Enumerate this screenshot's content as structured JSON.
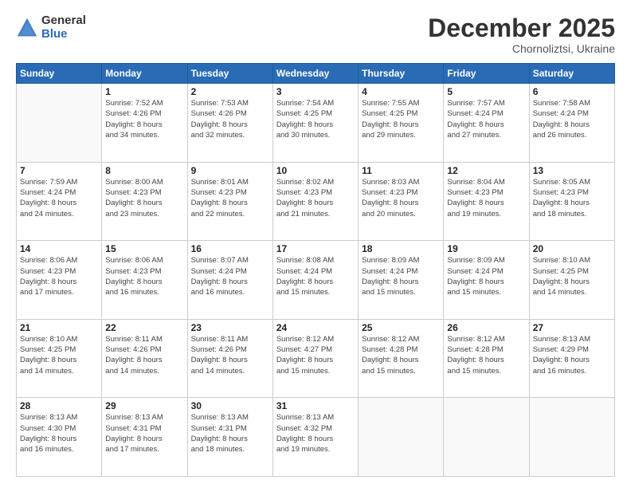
{
  "logo": {
    "general": "General",
    "blue": "Blue"
  },
  "title": "December 2025",
  "location": "Chornoliztsi, Ukraine",
  "weekdays": [
    "Sunday",
    "Monday",
    "Tuesday",
    "Wednesday",
    "Thursday",
    "Friday",
    "Saturday"
  ],
  "weeks": [
    [
      {
        "day": "",
        "info": ""
      },
      {
        "day": "1",
        "info": "Sunrise: 7:52 AM\nSunset: 4:26 PM\nDaylight: 8 hours\nand 34 minutes."
      },
      {
        "day": "2",
        "info": "Sunrise: 7:53 AM\nSunset: 4:26 PM\nDaylight: 8 hours\nand 32 minutes."
      },
      {
        "day": "3",
        "info": "Sunrise: 7:54 AM\nSunset: 4:25 PM\nDaylight: 8 hours\nand 30 minutes."
      },
      {
        "day": "4",
        "info": "Sunrise: 7:55 AM\nSunset: 4:25 PM\nDaylight: 8 hours\nand 29 minutes."
      },
      {
        "day": "5",
        "info": "Sunrise: 7:57 AM\nSunset: 4:24 PM\nDaylight: 8 hours\nand 27 minutes."
      },
      {
        "day": "6",
        "info": "Sunrise: 7:58 AM\nSunset: 4:24 PM\nDaylight: 8 hours\nand 26 minutes."
      }
    ],
    [
      {
        "day": "7",
        "info": "Sunrise: 7:59 AM\nSunset: 4:24 PM\nDaylight: 8 hours\nand 24 minutes."
      },
      {
        "day": "8",
        "info": "Sunrise: 8:00 AM\nSunset: 4:23 PM\nDaylight: 8 hours\nand 23 minutes."
      },
      {
        "day": "9",
        "info": "Sunrise: 8:01 AM\nSunset: 4:23 PM\nDaylight: 8 hours\nand 22 minutes."
      },
      {
        "day": "10",
        "info": "Sunrise: 8:02 AM\nSunset: 4:23 PM\nDaylight: 8 hours\nand 21 minutes."
      },
      {
        "day": "11",
        "info": "Sunrise: 8:03 AM\nSunset: 4:23 PM\nDaylight: 8 hours\nand 20 minutes."
      },
      {
        "day": "12",
        "info": "Sunrise: 8:04 AM\nSunset: 4:23 PM\nDaylight: 8 hours\nand 19 minutes."
      },
      {
        "day": "13",
        "info": "Sunrise: 8:05 AM\nSunset: 4:23 PM\nDaylight: 8 hours\nand 18 minutes."
      }
    ],
    [
      {
        "day": "14",
        "info": "Sunrise: 8:06 AM\nSunset: 4:23 PM\nDaylight: 8 hours\nand 17 minutes."
      },
      {
        "day": "15",
        "info": "Sunrise: 8:06 AM\nSunset: 4:23 PM\nDaylight: 8 hours\nand 16 minutes."
      },
      {
        "day": "16",
        "info": "Sunrise: 8:07 AM\nSunset: 4:24 PM\nDaylight: 8 hours\nand 16 minutes."
      },
      {
        "day": "17",
        "info": "Sunrise: 8:08 AM\nSunset: 4:24 PM\nDaylight: 8 hours\nand 15 minutes."
      },
      {
        "day": "18",
        "info": "Sunrise: 8:09 AM\nSunset: 4:24 PM\nDaylight: 8 hours\nand 15 minutes."
      },
      {
        "day": "19",
        "info": "Sunrise: 8:09 AM\nSunset: 4:24 PM\nDaylight: 8 hours\nand 15 minutes."
      },
      {
        "day": "20",
        "info": "Sunrise: 8:10 AM\nSunset: 4:25 PM\nDaylight: 8 hours\nand 14 minutes."
      }
    ],
    [
      {
        "day": "21",
        "info": "Sunrise: 8:10 AM\nSunset: 4:25 PM\nDaylight: 8 hours\nand 14 minutes."
      },
      {
        "day": "22",
        "info": "Sunrise: 8:11 AM\nSunset: 4:26 PM\nDaylight: 8 hours\nand 14 minutes."
      },
      {
        "day": "23",
        "info": "Sunrise: 8:11 AM\nSunset: 4:26 PM\nDaylight: 8 hours\nand 14 minutes."
      },
      {
        "day": "24",
        "info": "Sunrise: 8:12 AM\nSunset: 4:27 PM\nDaylight: 8 hours\nand 15 minutes."
      },
      {
        "day": "25",
        "info": "Sunrise: 8:12 AM\nSunset: 4:28 PM\nDaylight: 8 hours\nand 15 minutes."
      },
      {
        "day": "26",
        "info": "Sunrise: 8:12 AM\nSunset: 4:28 PM\nDaylight: 8 hours\nand 15 minutes."
      },
      {
        "day": "27",
        "info": "Sunrise: 8:13 AM\nSunset: 4:29 PM\nDaylight: 8 hours\nand 16 minutes."
      }
    ],
    [
      {
        "day": "28",
        "info": "Sunrise: 8:13 AM\nSunset: 4:30 PM\nDaylight: 8 hours\nand 16 minutes."
      },
      {
        "day": "29",
        "info": "Sunrise: 8:13 AM\nSunset: 4:31 PM\nDaylight: 8 hours\nand 17 minutes."
      },
      {
        "day": "30",
        "info": "Sunrise: 8:13 AM\nSunset: 4:31 PM\nDaylight: 8 hours\nand 18 minutes."
      },
      {
        "day": "31",
        "info": "Sunrise: 8:13 AM\nSunset: 4:32 PM\nDaylight: 8 hours\nand 19 minutes."
      },
      {
        "day": "",
        "info": ""
      },
      {
        "day": "",
        "info": ""
      },
      {
        "day": "",
        "info": ""
      }
    ]
  ]
}
